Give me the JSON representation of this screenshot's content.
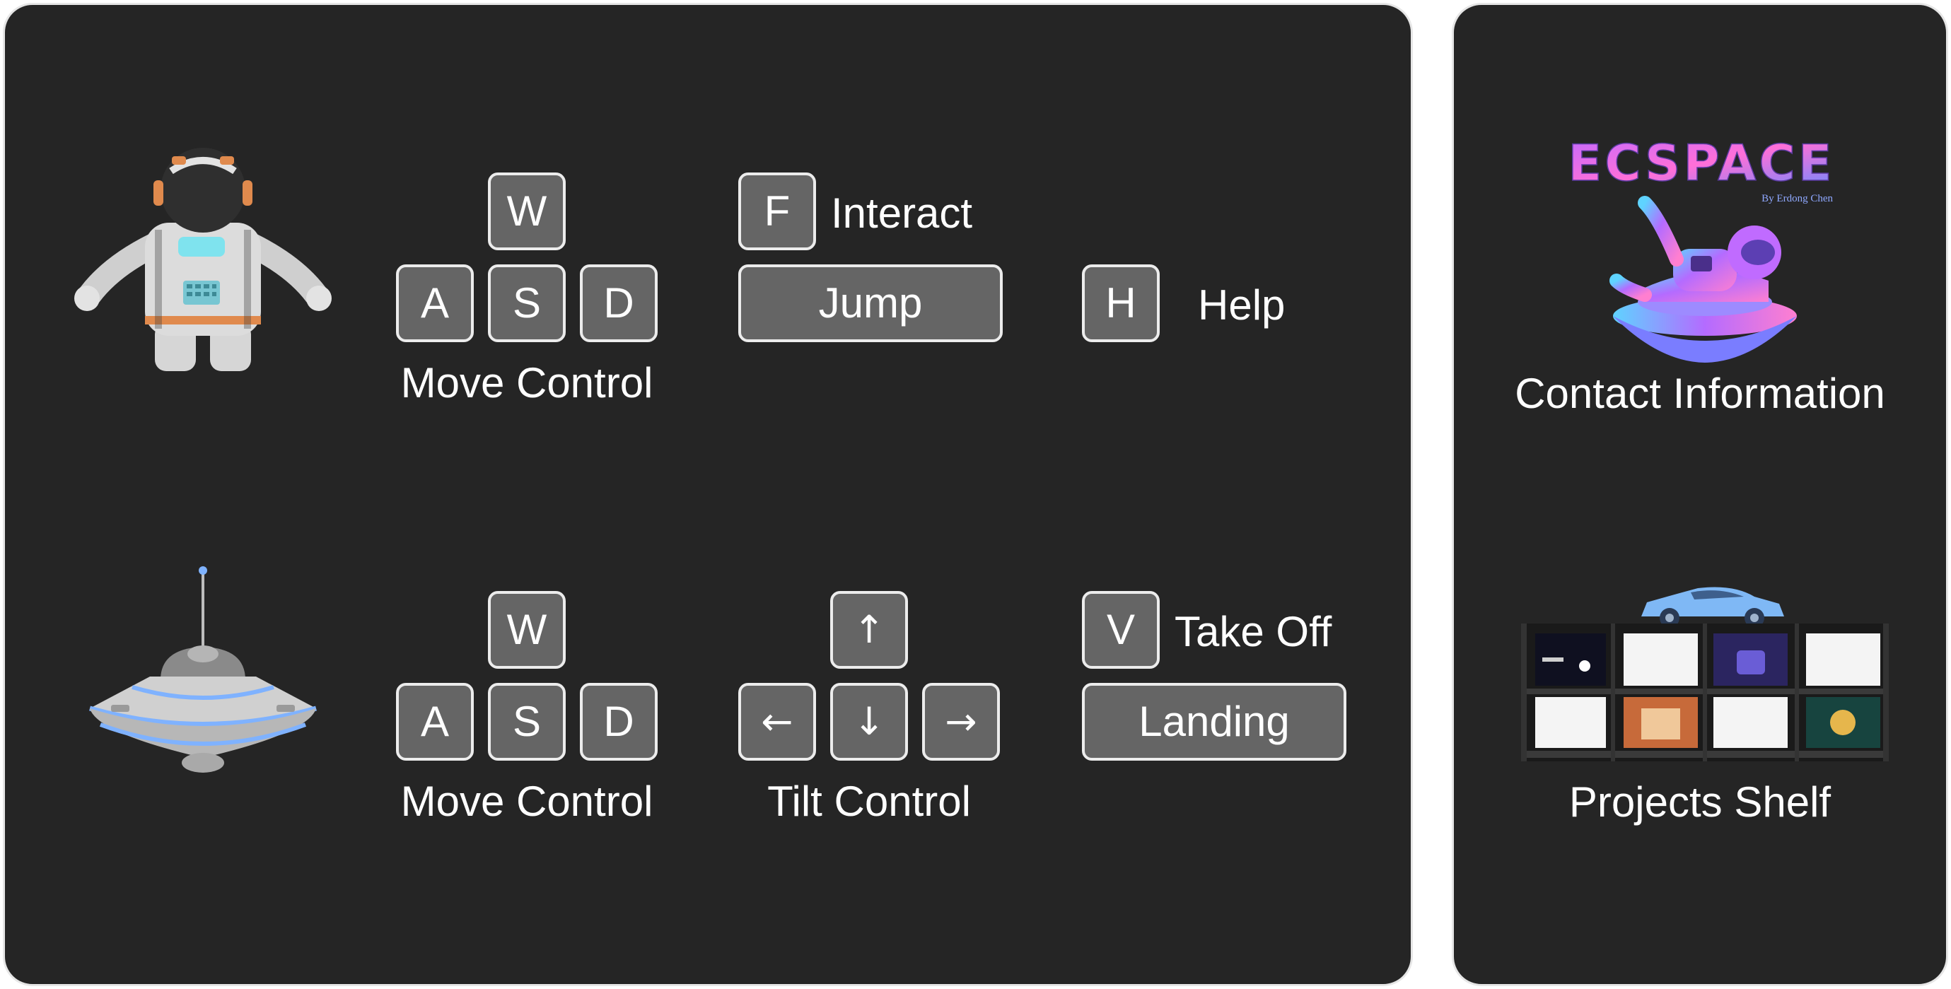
{
  "character_mode": {
    "move_control": {
      "keys": [
        "W",
        "A",
        "S",
        "D"
      ],
      "caption": "Move Control"
    },
    "interact": {
      "key": "F",
      "label": "Interact"
    },
    "jump": {
      "label": "Jump"
    },
    "help": {
      "key": "H",
      "label": "Help"
    }
  },
  "ufo_mode": {
    "move_control": {
      "keys": [
        "W",
        "A",
        "S",
        "D"
      ],
      "caption": "Move Control"
    },
    "tilt_control": {
      "keys": [
        "↑",
        "←",
        "↓",
        "→"
      ],
      "caption": "Tilt Control"
    },
    "take_off": {
      "key": "V",
      "label": "Take Off"
    },
    "landing": {
      "label": "Landing"
    }
  },
  "side_panel": {
    "logo": {
      "title": "ECSPACE",
      "byline": "By Erdong Chen"
    },
    "contact": {
      "label": "Contact Information"
    },
    "projects": {
      "label": "Projects Shelf"
    }
  },
  "colors": {
    "panel_bg": "#252525",
    "panel_border": "#e6e6e6",
    "key_bg": "#656565",
    "key_border": "#ececec",
    "text": "#ffffff"
  },
  "icons": [
    "astronaut-icon",
    "ufo-icon",
    "ecspace-logo",
    "astronaut-on-platform-icon",
    "car-icon",
    "projects-shelf-icon"
  ]
}
